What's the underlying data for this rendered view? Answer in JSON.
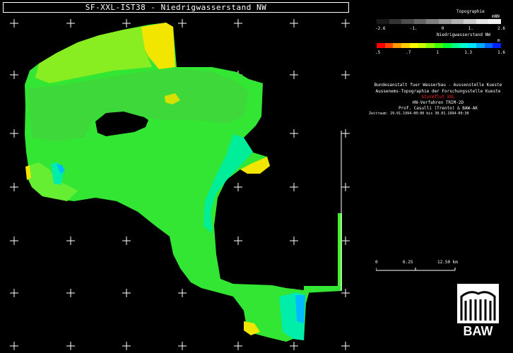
{
  "title": "SF-XXL-IST38 - Niedrigwasserstand NW",
  "legend": {
    "topo": {
      "title": "Topographie",
      "unit": "mNN",
      "ticks": [
        "-2.6",
        "-1.",
        "0",
        "1.",
        "2.6"
      ],
      "colors": [
        "#1a1a1a",
        "#333333",
        "#4d4d4d",
        "#666666",
        "#808080",
        "#999999",
        "#b3b3b3",
        "#cccccc",
        "#e6e6e6",
        "#f2f2f2"
      ]
    },
    "nw": {
      "title": "Niedrigwasserstand NW",
      "unit": "m",
      "ticks": [
        ".5",
        ".7",
        "1",
        "1.3",
        "1.6"
      ],
      "colors": [
        "#ff0000",
        "#ff4400",
        "#ff9900",
        "#ffcc00",
        "#ffff00",
        "#ccff00",
        "#88ff00",
        "#44ff00",
        "#00ff33",
        "#00ff88",
        "#00ffcc",
        "#00e5ff",
        "#00aaff",
        "#0066ff",
        "#0022ff"
      ]
    }
  },
  "info": {
    "line1": "Bundesanstalt fuer Wasserbau - Aussenstelle Kueste",
    "line2": "Aussenems-Topographie der Forschungsstelle Kueste",
    "line3": "Sturmflut XXL",
    "line4": "HN-Verfahren TRIM-2D",
    "line5": "Prof. Casulli (Trento) & BAW-AK",
    "line6": "Zeitraum: 29.01.1994-00:00 bis 30.01.1994-00:30"
  },
  "scale": {
    "ticks": [
      "0",
      "6.25",
      "12.50 km"
    ]
  },
  "logo_text": "BAW",
  "colors": {
    "water_main": "#33e633",
    "water_light": "#77ee22",
    "water_cyan": "#00ee99",
    "water_blue": "#00bbff",
    "water_yellow": "#f2e600",
    "accent_red": "#ff2222"
  }
}
